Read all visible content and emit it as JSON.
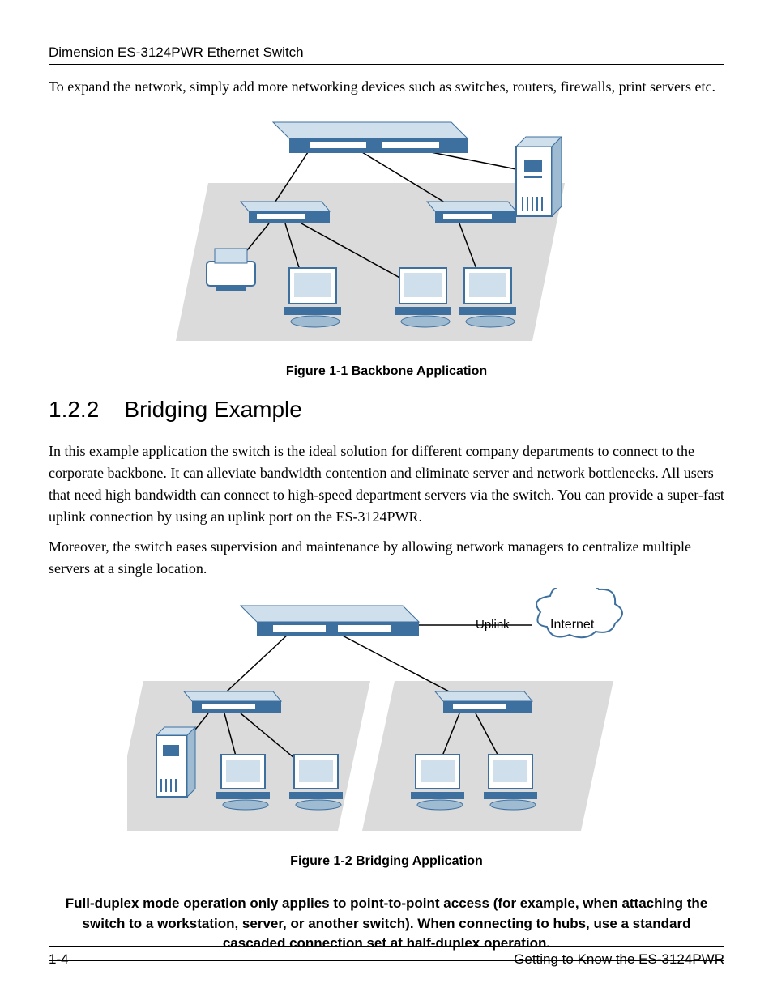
{
  "header": {
    "product_line": "Dimension ES-3124PWR Ethernet Switch"
  },
  "intro_paragraph": "To expand the network, simply add more networking devices such as switches, routers, firewalls, print servers etc.",
  "figure1": {
    "caption": "Figure 1-1 Backbone Application"
  },
  "section": {
    "number": "1.2.2",
    "title": "Bridging Example"
  },
  "section_paragraph1": "In this example application the switch is the ideal solution for different company departments to connect to the corporate backbone. It can alleviate bandwidth contention and eliminate server and network bottlenecks. All users that need high bandwidth can connect to high-speed department servers via the switch. You can provide a super-fast uplink connection by using an uplink port on the ES-3124PWR.",
  "section_paragraph2": "Moreover, the switch eases supervision and maintenance by allowing network managers to centralize multiple servers at a single location.",
  "figure2": {
    "caption": "Figure 1-2 Bridging Application",
    "uplink_label": "Uplink",
    "internet_label": "Internet"
  },
  "note": "Full-duplex mode operation only applies to point-to-point access (for example, when attaching the switch to a workstation, server, or another switch). When connecting to hubs, use a standard cascaded connection set at half-duplex operation.",
  "footer": {
    "page": "1-4",
    "chapter": "Getting to Know the ES-3124PWR"
  },
  "colors": {
    "device_blue": "#3e709f",
    "device_light": "#cfe0ec",
    "shadow": "#bdbdbd",
    "line": "#000000"
  }
}
